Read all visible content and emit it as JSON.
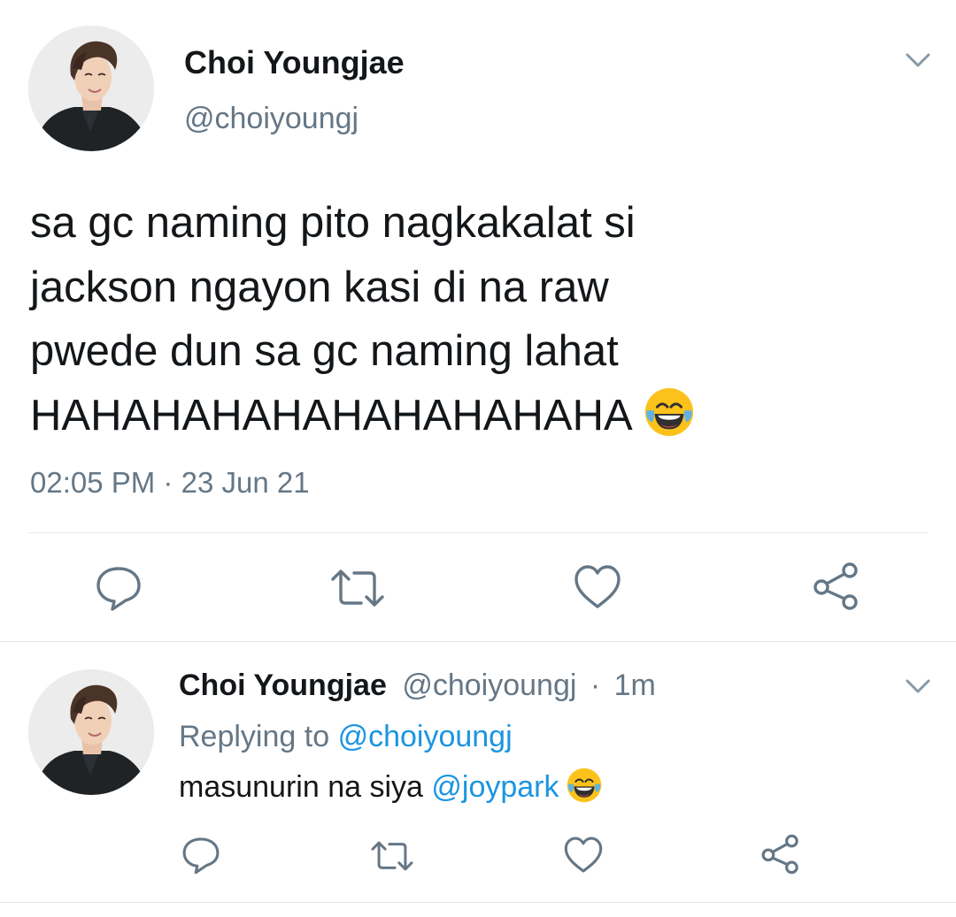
{
  "tweet": {
    "display_name": "Choi Youngjae",
    "handle": "@choiyoungj",
    "text_lines": [
      "sa gc naming pito nagkakalat si",
      "jackson ngayon kasi di na raw",
      "pwede dun sa gc naming lahat",
      "HAHAHAHAHAHAHAHAHAHA"
    ],
    "emoji": "face-with-tears-of-joy",
    "time": "02:05 PM",
    "separator": "·",
    "date": "23 Jun 21",
    "avatar_icon": "profile-photo",
    "menu_icon": "chevron-down-icon",
    "actions": {
      "reply_icon": "comment-icon",
      "retweet_icon": "retweet-icon",
      "like_icon": "heart-icon",
      "share_icon": "share-icon"
    }
  },
  "reply": {
    "display_name": "Choi Youngjae",
    "handle": "@choiyoungj",
    "separator": "·",
    "time_ago": "1m",
    "replying_prefix": "Replying to",
    "replying_to": "@choiyoungj",
    "text": "masunurin na siya",
    "mention": "@joypark",
    "emoji": "face-with-tears-of-joy"
  },
  "colors": {
    "text": "#14171a",
    "secondary": "#657786",
    "link": "#1b95e0",
    "icon": "#657786",
    "divider": "#e1e8ed"
  }
}
